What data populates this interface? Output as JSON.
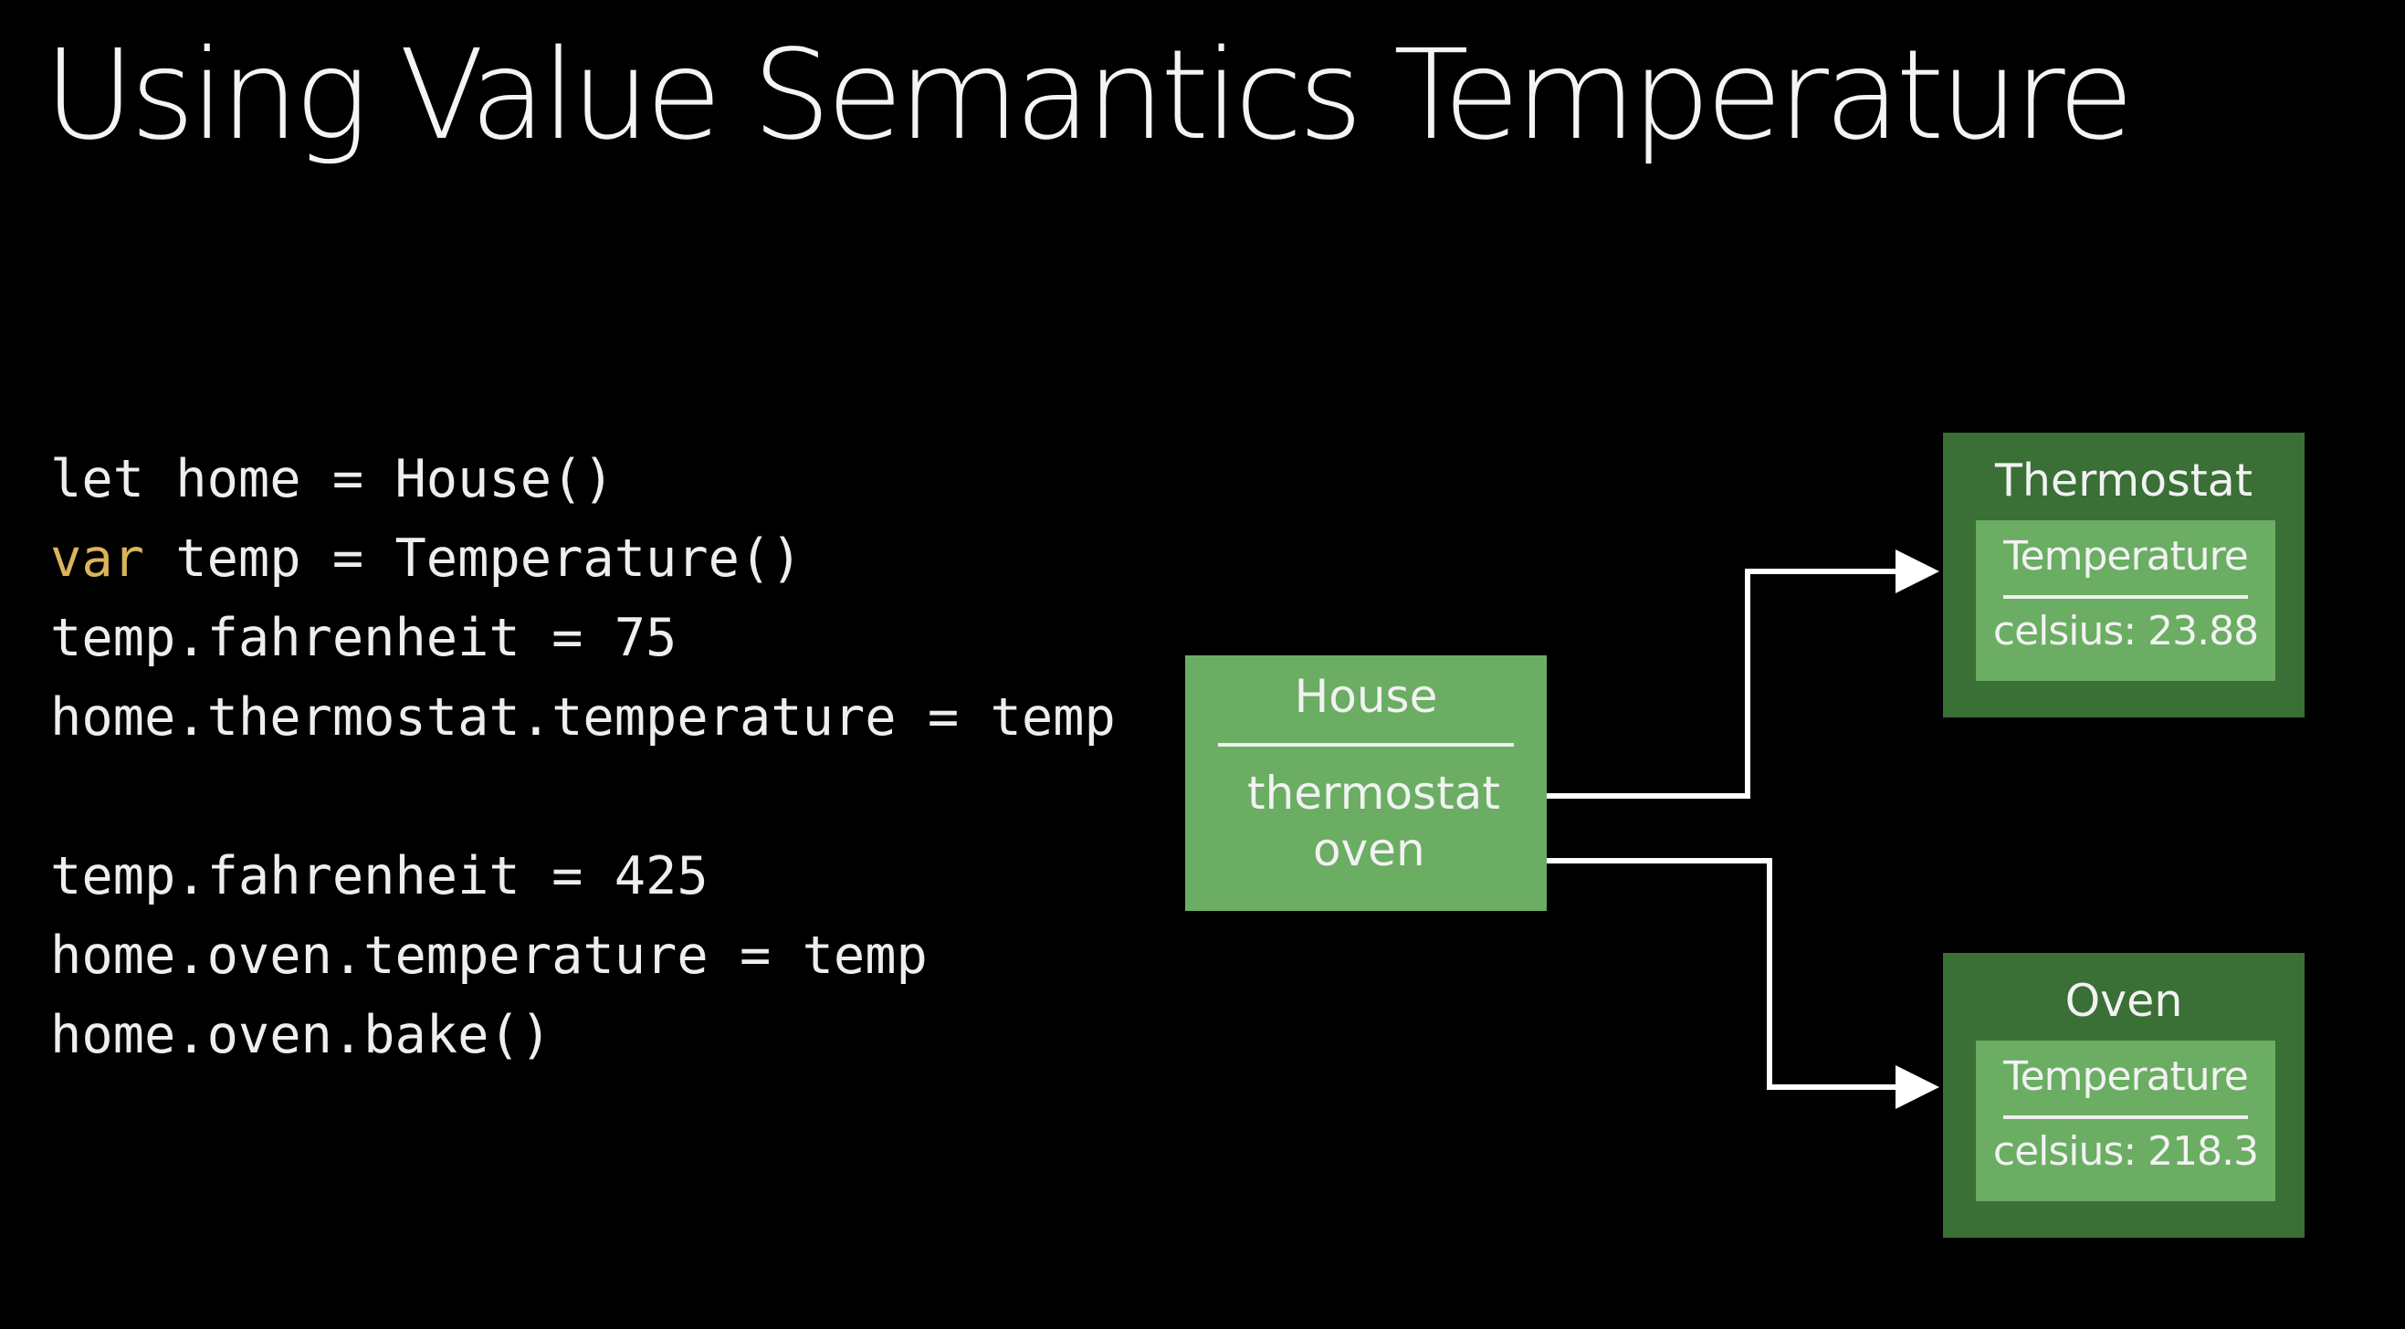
{
  "slide": {
    "title": "Using Value Semantics Temperature"
  },
  "code": {
    "line1": "let home = House()",
    "line2_keyword": "var",
    "line2_rest": " temp = Temperature()",
    "line3": "temp.fahrenheit = 75",
    "line4": "home.thermostat.temperature = temp",
    "line5": "temp.fahrenheit = 425",
    "line6": "home.oven.temperature = temp",
    "line7": "home.oven.bake()"
  },
  "diagram": {
    "house": {
      "title": "House",
      "field_thermostat": "thermostat",
      "field_oven": "oven"
    },
    "thermostat": {
      "title": "Thermostat",
      "inner_title": "Temperature",
      "inner_value": "celsius: 23.88"
    },
    "oven": {
      "title": "Oven",
      "inner_title": "Temperature",
      "inner_value": "celsius: 218.3"
    }
  },
  "colors": {
    "background": "#000000",
    "keyword": "#d9b45b",
    "light_green": "#6aad63",
    "dark_green": "#3a6f36",
    "arrow": "#ffffff"
  }
}
